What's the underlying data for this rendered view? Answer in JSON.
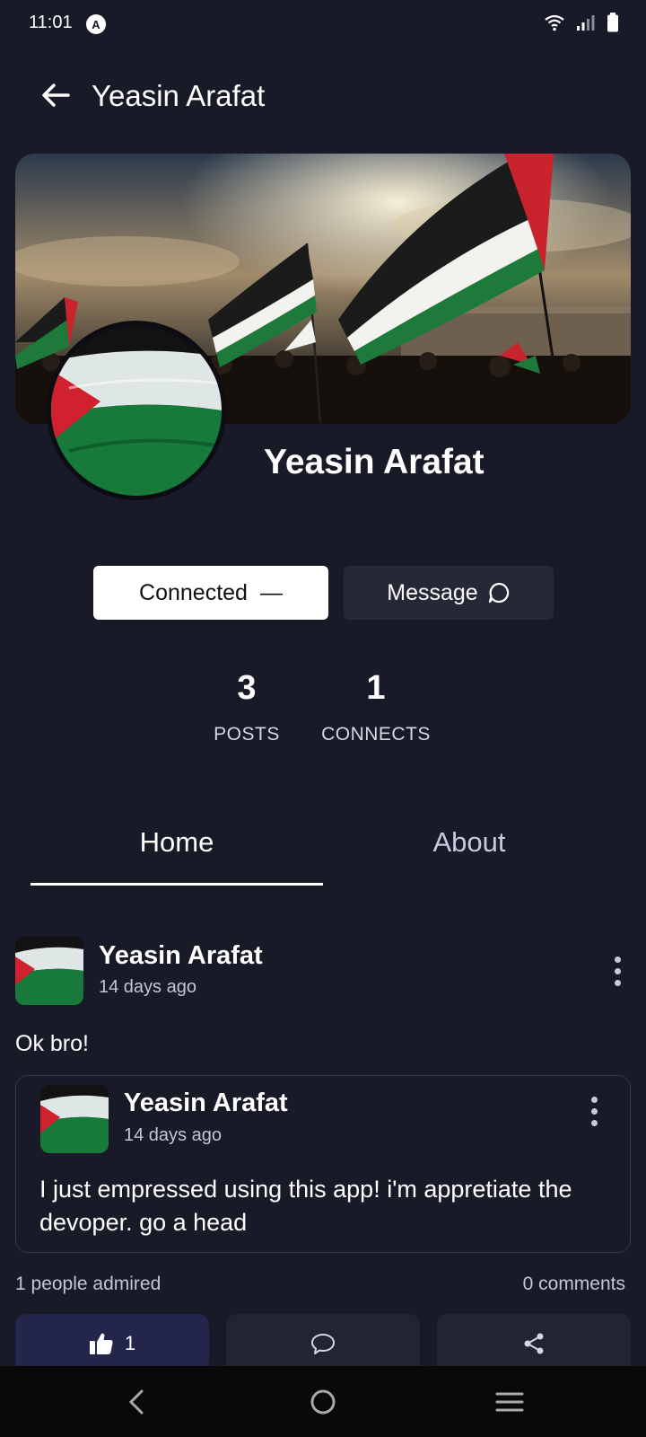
{
  "status_bar": {
    "time": "11:01",
    "badge": "A",
    "icons": [
      "wifi-icon",
      "signal-icon",
      "battery-icon"
    ]
  },
  "header": {
    "title": "Yeasin Arafat"
  },
  "profile": {
    "name": "Yeasin Arafat",
    "connected_label": "Connected",
    "connected_symbol": "—",
    "message_label": "Message",
    "stats": [
      {
        "value": "3",
        "label": "POSTS"
      },
      {
        "value": "1",
        "label": "CONNECTS"
      }
    ]
  },
  "tabs": [
    {
      "label": "Home",
      "active": true
    },
    {
      "label": "About",
      "active": false
    }
  ],
  "post": {
    "author": "Yeasin Arafat",
    "time": "14 days ago",
    "text": "Ok bro!",
    "quoted": {
      "author": "Yeasin Arafat",
      "time": "14 days ago",
      "text": "I just empressed using this app! i'm appretiate the devoper. go a head"
    },
    "admired": "1 people admired",
    "comments": "0 comments",
    "likes": "1"
  },
  "colors": {
    "background": "#181a27",
    "card": "#222431",
    "like_active": "#23264a",
    "flag_red": "#d1212f",
    "flag_green": "#1d7a3a"
  }
}
